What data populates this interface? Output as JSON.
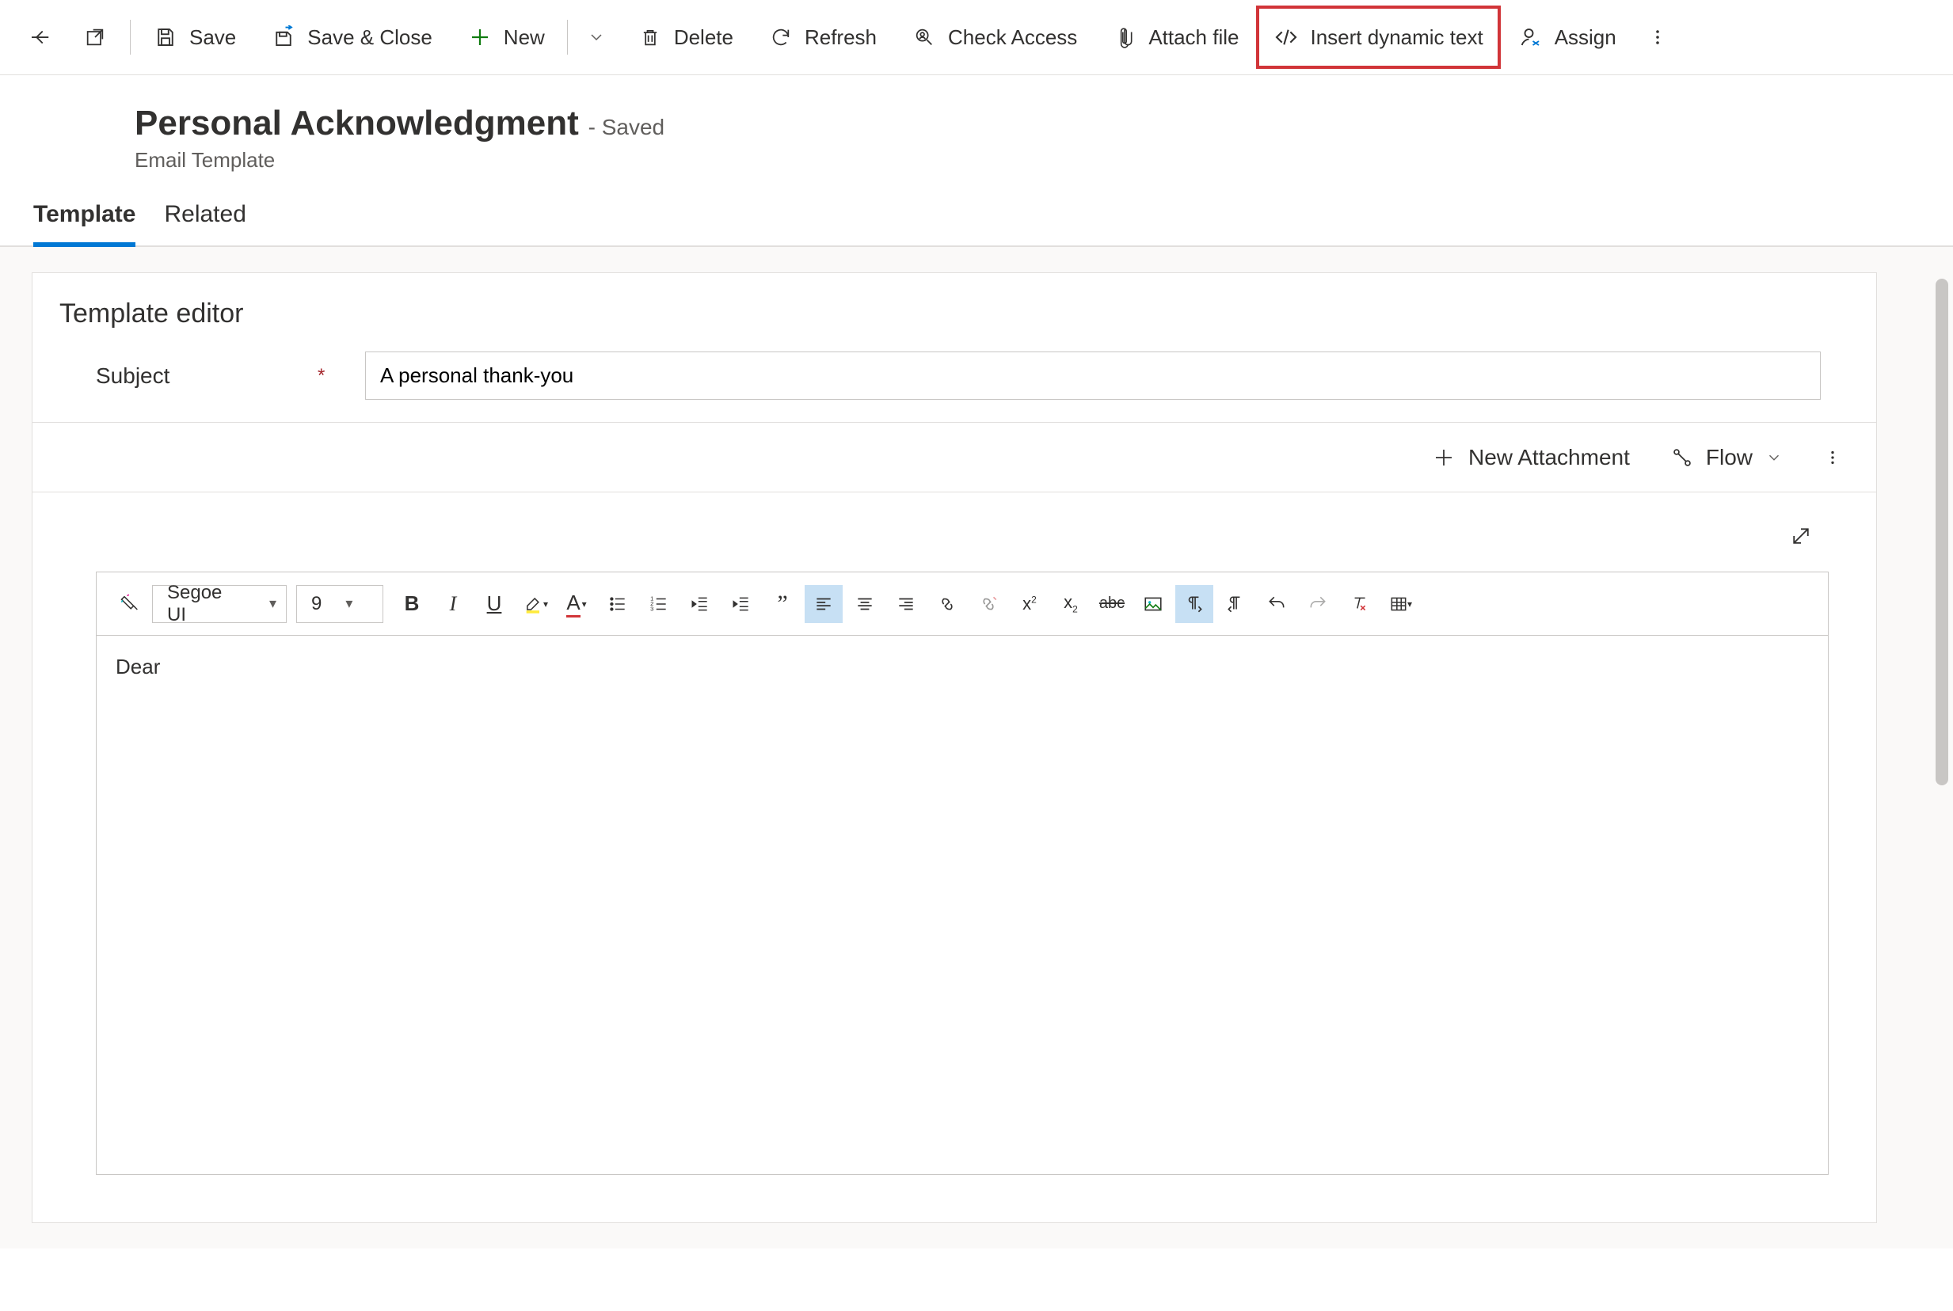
{
  "toolbar": {
    "save": "Save",
    "save_close": "Save & Close",
    "new": "New",
    "delete": "Delete",
    "refresh": "Refresh",
    "check_access": "Check Access",
    "attach_file": "Attach file",
    "insert_dynamic": "Insert dynamic text",
    "assign": "Assign"
  },
  "header": {
    "title": "Personal Acknowledgment",
    "saved_suffix": "- Saved",
    "subtype": "Email Template"
  },
  "tabs": {
    "template": "Template",
    "related": "Related"
  },
  "editor": {
    "section_title": "Template editor",
    "subject_label": "Subject",
    "subject_value": "A personal thank-you",
    "new_attachment": "New Attachment",
    "flow": "Flow",
    "font_name": "Segoe UI",
    "font_size": "9",
    "body_text": "Dear"
  }
}
